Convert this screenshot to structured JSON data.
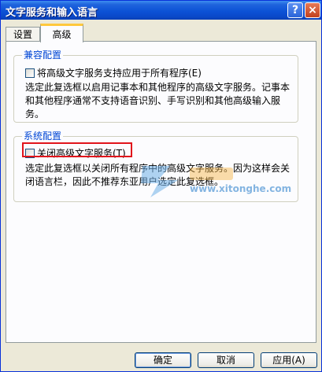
{
  "window": {
    "title": "文字服务和输入语言",
    "help_button": "?",
    "close_button": "×"
  },
  "tabs": [
    {
      "label": "设置",
      "selected": false
    },
    {
      "label": "高级",
      "selected": true
    }
  ],
  "compat_group": {
    "legend": "兼容配置",
    "checkbox_label": "将高级文字服务支持应用于所有程序(E)",
    "checked": false,
    "description_lines": [
      "选定此复选框以启用记事本和其他程序的高级文字服务。记事本",
      "和其他程序通常不支持语音识别、手写识别和其他高级输入服",
      "务。"
    ]
  },
  "system_group": {
    "legend": "系统配置",
    "checkbox_label": "关闭高级文字服务(T)",
    "checked": false,
    "description_lines": [
      "选定此复选框以关闭所有程序中的高级文字服务。因为这样会关",
      "闭语言栏，因此不推荐东亚用户选定此复选框。"
    ]
  },
  "watermark": {
    "text": "www.xitonghe.com"
  },
  "buttons": {
    "ok": "确定",
    "cancel": "取消",
    "apply": "应用(A)"
  },
  "colors": {
    "titlebar": "#0a48c8",
    "group_label": "#0046d5",
    "highlight": "#e1141b",
    "tab_accent": "#ffc83c"
  }
}
